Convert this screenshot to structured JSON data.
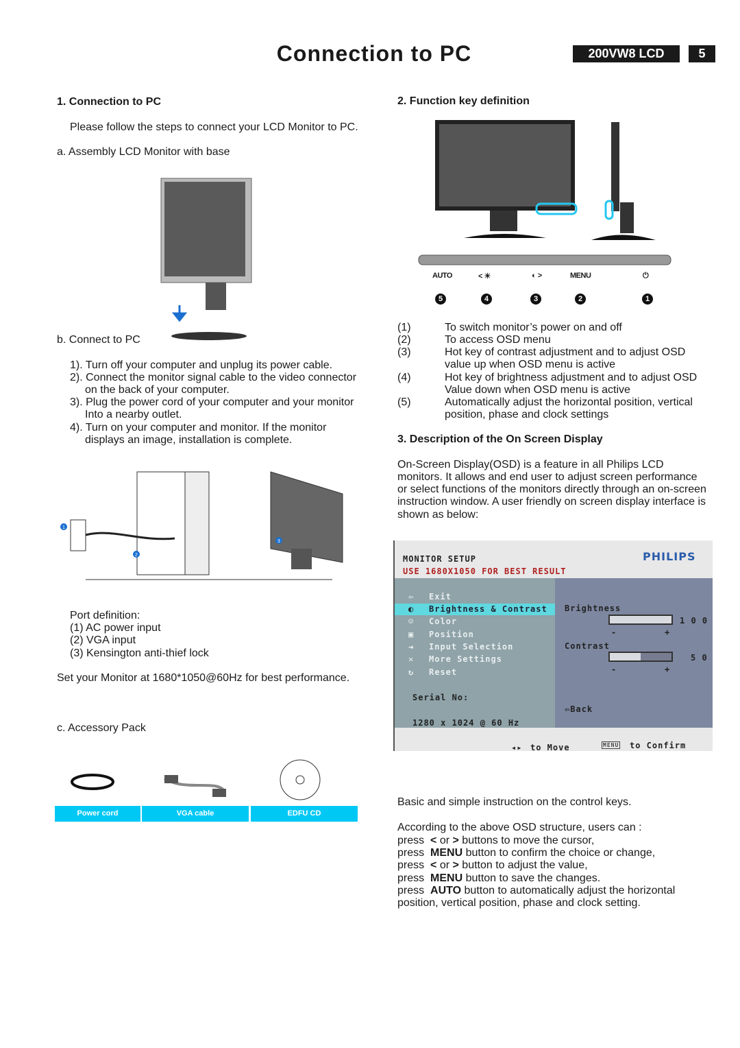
{
  "header": {
    "title": "Connection to PC",
    "model": "200VW8 LCD",
    "page": "5"
  },
  "left": {
    "s1_heading": "1. Connection to PC",
    "s1_intro": "Please follow the steps to connect your LCD Monitor to PC.",
    "a_label": "a. Assembly LCD Monitor with base",
    "b_label": "b. Connect to PC",
    "steps": [
      "1). Turn off your computer and unplug its power cable.",
      "2). Connect the monitor signal cable to the video connector",
      "on the back of your computer.",
      "3). Plug the power cord of your computer and your monitor",
      "Into a nearby outlet.",
      "4). Turn on your  computer and monitor. If the monitor",
      "displays an image, installation is complete."
    ],
    "port_heading": "Port definition:",
    "ports": [
      "(1) AC power input",
      "(2) VGA input",
      "(3) Kensington anti-thief lock"
    ],
    "best": "Set your Monitor at 1680*1050@60Hz for best performance.",
    "c_label": "c. Accessory Pack",
    "callouts": [
      "1",
      "2",
      "3"
    ],
    "accessories": [
      "Power cord",
      "VGA  cable",
      "EDFU  CD"
    ]
  },
  "right": {
    "s2_heading": "2. Function key definition",
    "keys": [
      {
        "label": "AUTO",
        "num": "5"
      },
      {
        "label": "< ☀",
        "num": "4"
      },
      {
        "label": "◐ >",
        "num": "3"
      },
      {
        "label": "MENU",
        "num": "2"
      },
      {
        "label": "⏻",
        "num": "1"
      }
    ],
    "defs": [
      {
        "n": "(1)",
        "lines": [
          "To switch monitor’s power on and off"
        ]
      },
      {
        "n": "(2)",
        "lines": [
          "To access OSD menu"
        ]
      },
      {
        "n": "(3)",
        "lines": [
          "Hot key of contrast adjustment and to adjust OSD",
          " value up when OSD menu is active"
        ]
      },
      {
        "n": "(4)",
        "lines": [
          "Hot key of brightness adjustment and to adjust OSD",
          " Value down when OSD menu is active"
        ]
      },
      {
        "n": "(5)",
        "lines": [
          "Automatically adjust the horizontal position, vertical",
          " position, phase and clock settings"
        ]
      }
    ],
    "s3_heading": "3. Description of the On Screen Display",
    "s3_para": [
      "On-Screen Display(OSD) is a feature in all Philips LCD",
      "monitors. It allows and end user to adjust screen performance",
      "or select functions of the monitors directly through an on-screen",
      "instruction window. A user friendly on screen display interface is",
      "shown as below:"
    ],
    "basic": "Basic and simple instruction on the control keys.",
    "according": "According to the above OSD structure, users can :",
    "instructions": [
      {
        "pre": "press ",
        "key": "< ",
        "mid": "or ",
        "key2": "> ",
        "post": " buttons to move the cursor,"
      },
      {
        "pre": "press ",
        "key": "MENU",
        "mid": "",
        "key2": "",
        "post": " button to confirm the choice or change,"
      },
      {
        "pre": "press ",
        "key": "< ",
        "mid": "or ",
        "key2": "> ",
        "post": " button to adjust the value,"
      },
      {
        "pre": "press ",
        "key": "MENU",
        "mid": "",
        "key2": "",
        "post": " button to save the changes."
      },
      {
        "pre": "press ",
        "key": "AUTO",
        "mid": "",
        "key2": "",
        "post": " button to automatically adjust the horizontal"
      }
    ],
    "last_line": "position, vertical position, phase and clock setting."
  },
  "osd": {
    "title": "MONITOR SETUP",
    "brand": "PHILIPS",
    "hint": "USE 1680X1050 FOR BEST RESULT",
    "menu": [
      "Exit",
      "Brightness & Contrast",
      "Color",
      "Position",
      "Input Selection",
      "More Settings",
      "Reset"
    ],
    "selected": "Brightness & Contrast",
    "brightness_label": "Brightness",
    "brightness_value": "1 0 0",
    "brightness_level": 100,
    "contrast_label": "Contrast",
    "contrast_value": "5 0",
    "contrast_level": 50,
    "minus": "-",
    "plus": "+",
    "serial": "Serial No:",
    "mode": "1280  x 1024 @ 60 Hz",
    "back": "Back",
    "move": "to Move",
    "menu_key": "MENU",
    "confirm": "to Confirm",
    "colors": {
      "left_panel": "#8fa3a8",
      "right_panel": "#7d87a0",
      "highlight": "#5fd8e0",
      "hint": "#b02020",
      "brand": "#2a5caa"
    }
  },
  "colors": {
    "accent": "#00c8f5"
  }
}
